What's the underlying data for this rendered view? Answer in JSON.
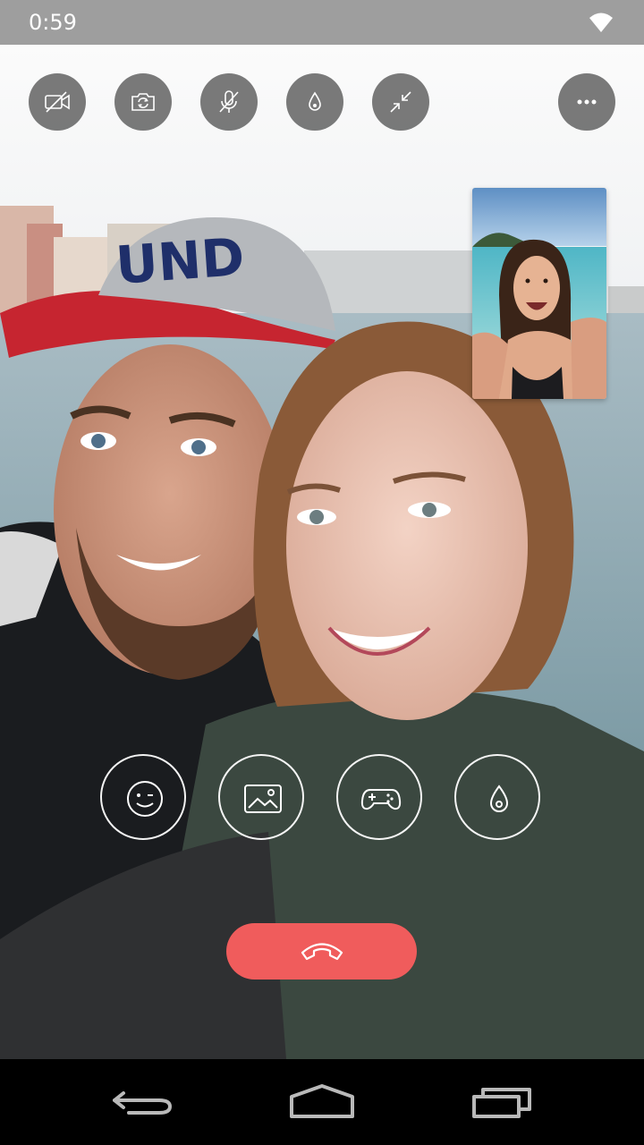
{
  "status_bar": {
    "time": "0:59",
    "background": "#9e9e9e",
    "wifi_icon": "wifi-icon"
  },
  "top_controls": [
    {
      "name": "camera-off-button",
      "icon": "video-off-icon"
    },
    {
      "name": "switch-camera-button",
      "icon": "camera-switch-icon"
    },
    {
      "name": "mute-button",
      "icon": "mic-off-icon"
    },
    {
      "name": "filter-button",
      "icon": "drop-icon"
    },
    {
      "name": "minimize-button",
      "icon": "collapse-arrows-icon"
    },
    {
      "name": "more-options-button",
      "icon": "more-dots-icon"
    }
  ],
  "effects": [
    {
      "name": "emoji-button",
      "icon": "wink-face-icon"
    },
    {
      "name": "sticker-button",
      "icon": "image-icon"
    },
    {
      "name": "game-button",
      "icon": "gamepad-icon"
    },
    {
      "name": "filter-effect-button",
      "icon": "drop-icon"
    }
  ],
  "end_call": {
    "icon": "phone-hangup-icon",
    "color": "#f05c5c"
  },
  "navigation": {
    "back_icon": "back-icon",
    "home_icon": "home-icon",
    "recents_icon": "recents-icon"
  }
}
